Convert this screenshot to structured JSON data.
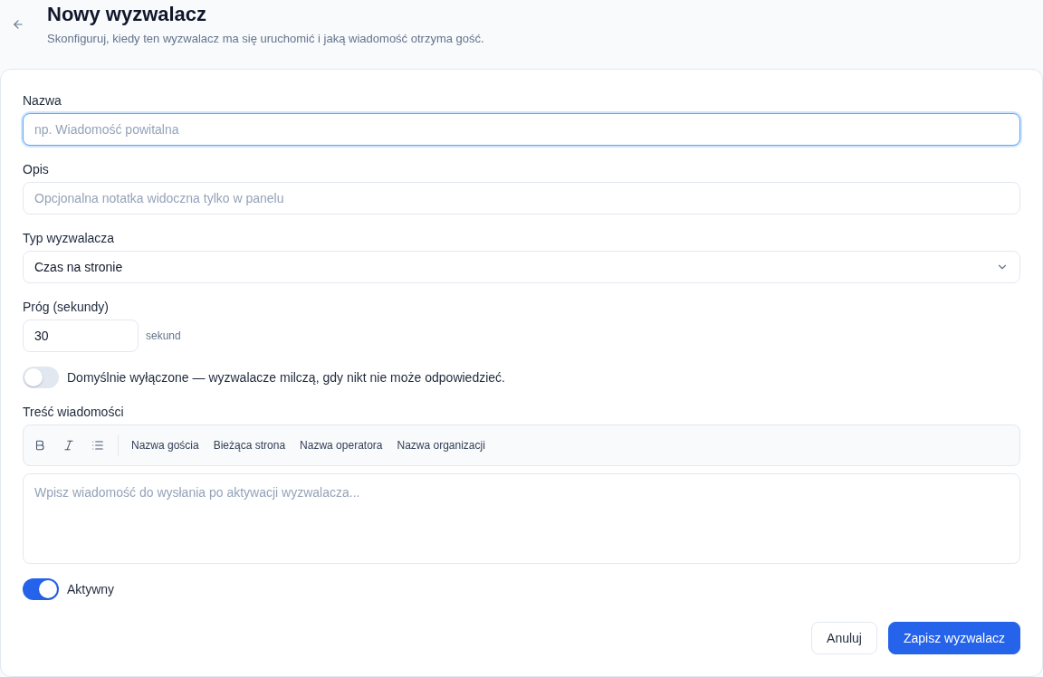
{
  "header": {
    "title": "Nowy wyzwalacz",
    "subtitle": "Skonfiguruj, kiedy ten wyzwalacz ma się uruchomić i jaką wiadomość otrzyma gość."
  },
  "form": {
    "fields": [
      {
        "kind": "text",
        "label": "Nazwa",
        "placeholder": "np. Wiadomość powitalna",
        "focused": true
      },
      {
        "kind": "text",
        "label": "Opis",
        "placeholder": "Opcjonalna notatka widoczna tylko w panelu",
        "focused": false
      },
      {
        "kind": "select",
        "label": "Typ wyzwalacza",
        "value": "Czas na stronie",
        "focused": false
      },
      {
        "kind": "number",
        "label": "Próg (sekundy)",
        "value": "30",
        "unit": "sekund",
        "focused": false
      },
      {
        "kind": "toggle",
        "label": "Domyślnie wyłączone — wyzwalacze milczą, gdy nikt nie może odpowiedzieć.",
        "on": false
      },
      {
        "kind": "editor",
        "label": "Treść wiadomości",
        "variables": [
          "Nazwa gościa",
          "Bieżąca strona",
          "Nazwa operatora",
          "Nazwa organizacji"
        ],
        "placeholder": "Wpisz wiadomość do wysłania po aktywacji wyzwalacza...",
        "focused": false
      },
      {
        "kind": "toggle",
        "label": "Aktywny",
        "on": true
      }
    ]
  },
  "actions": [
    {
      "kind": "secondary",
      "label": "Anuluj"
    },
    {
      "kind": "primary",
      "label": "Zapisz wyzwalacz"
    }
  ]
}
